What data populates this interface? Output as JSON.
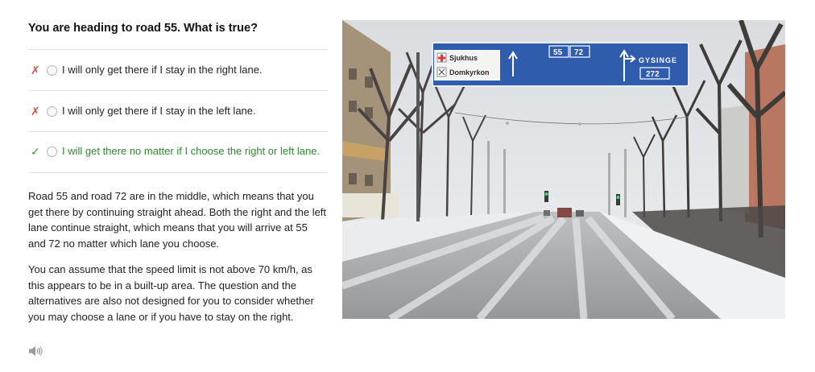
{
  "question": {
    "text": "You are heading to road 55. What is true?"
  },
  "options": [
    {
      "mark": "✗",
      "label": "I will only get there if I stay in the right lane.",
      "status": "incorrect"
    },
    {
      "mark": "✗",
      "label": "I will only get there if I stay in the left lane.",
      "status": "incorrect"
    },
    {
      "mark": "✓",
      "label": "I will get there no matter if I choose the right or left lane.",
      "status": "correct"
    }
  ],
  "explanation": [
    "Road 55 and road 72 are in the middle, which means that you get there by continuing straight ahead. Both the right and the left lane continue straight, which means that you will arrive at 55 and 72 no matter which lane you choose.",
    "You can assume that the speed limit is not above 70 km/h, as this appears to be in a built-up area. The question and the alternatives are also not designed for you to consider whether you may choose a lane or if you have to stay on the right."
  ],
  "audio": {
    "icon": "speaker-icon"
  },
  "photo": {
    "sign": {
      "left_top": "Sjukhus",
      "left_bottom": "Domkyrkon",
      "road_a": "55",
      "road_b": "72",
      "right_dest": "GYSINGE",
      "right_road": "272"
    }
  },
  "colors": {
    "correct": "#2f8a2f",
    "incorrect": "#d9534f",
    "sign_blue": "#1f4fa8"
  }
}
